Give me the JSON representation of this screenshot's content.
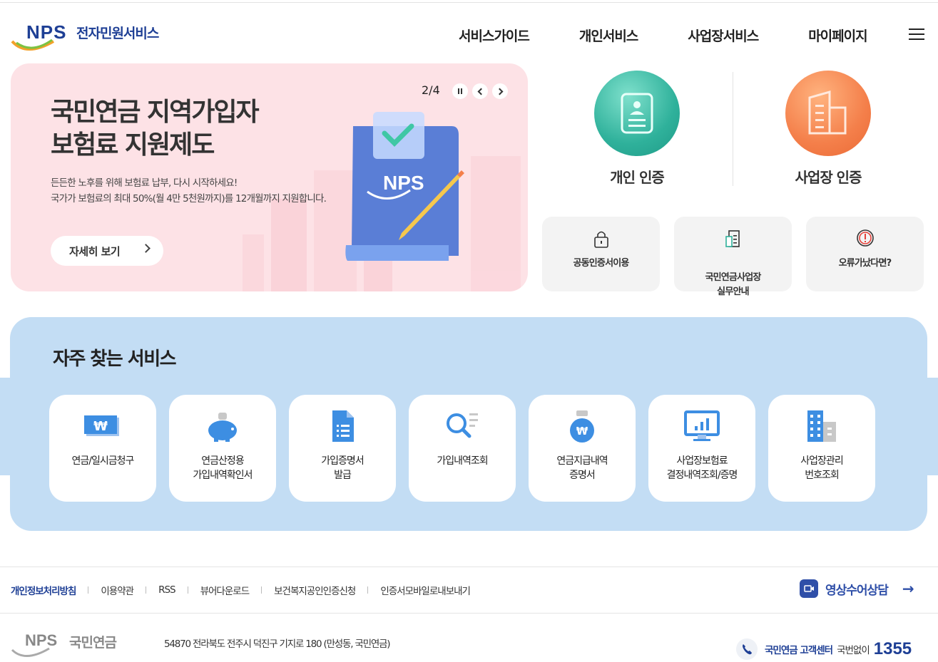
{
  "header": {
    "logo_mark": "NPS",
    "logo_text": "전자민원서비스",
    "nav": [
      "서비스가이드",
      "개인서비스",
      "사업장서비스",
      "마이페이지"
    ]
  },
  "hero": {
    "title_line1": "국민연금 지역가입자",
    "title_line2": "보험료 지원제도",
    "desc_line1": "든든한 노후를 위해 보험료 납부, 다시 시작하세요!",
    "desc_line2": "국가가 보험료의 최대 50%(월 4만 5천원까지)를 12개월까지 지원합니다.",
    "more_label": "자세히 보기",
    "pager": "2/4",
    "illus_text": "NPS"
  },
  "auth": {
    "personal": "개인 인증",
    "business": "사업장 인증"
  },
  "quick": [
    {
      "label": "공동인증서이용",
      "icon": "lock-icon"
    },
    {
      "label": "국민연금사업장\n실무안내",
      "icon": "document-icon"
    },
    {
      "label": "오류가났다면?",
      "icon": "alert-icon"
    }
  ],
  "frequent": {
    "title": "자주 찾는 서비스",
    "items": [
      {
        "label": "연금/일시금청구",
        "icon": "won-bill-icon"
      },
      {
        "label": "연금산정용\n가입내역확인서",
        "icon": "piggy-bank-icon"
      },
      {
        "label": "가입증명서\n발급",
        "icon": "document-list-icon"
      },
      {
        "label": "가입내역조회",
        "icon": "search-list-icon"
      },
      {
        "label": "연금지급내역\n증명서",
        "icon": "money-bag-icon"
      },
      {
        "label": "사업장보험료\n결정내역조회/증명",
        "icon": "monitor-chart-icon"
      },
      {
        "label": "사업장관리\n번호조회",
        "icon": "building-icon"
      }
    ]
  },
  "footer": {
    "links": [
      "개인정보처리방침",
      "이용약관",
      "RSS",
      "뷰어다운로드",
      "보건복지공인인증신청",
      "인증서모바일로내보내기"
    ],
    "video": "영상수어상담",
    "logo_mark": "NPS",
    "logo_text": "국민연금",
    "address": "54870 전라북도 전주시 덕진구 기지로 180 (만성동, 국민연금)",
    "callcenter_label": "국민연금 고객센터",
    "callcenter_sub": "국번없이",
    "callcenter_number": "1355"
  },
  "colors": {
    "brand": "#1e3f95",
    "hero_bg": "#fde2e6",
    "frequent_bg": "#c3ddf4",
    "personal_auth": "#2fb19b",
    "business_auth": "#f47f4a"
  }
}
